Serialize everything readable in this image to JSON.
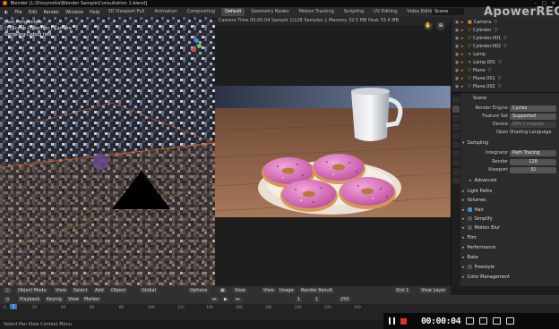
{
  "titlebar": {
    "title": "Blender [L:\\Dizzynotta\\Blender Sample\\Consultation 1.blend]"
  },
  "menu": [
    "File",
    "Edit",
    "Render",
    "Window",
    "Help"
  ],
  "workspaces": [
    {
      "label": "3D Viewport Full",
      "active": false
    },
    {
      "label": "Animation",
      "active": false
    },
    {
      "label": "Compositing",
      "active": false
    },
    {
      "label": "Default",
      "active": true
    },
    {
      "label": "Geometry Nodes",
      "active": false
    },
    {
      "label": "Motion Tracking",
      "active": false
    },
    {
      "label": "Scripting",
      "active": false
    },
    {
      "label": "UV Editing",
      "active": false
    },
    {
      "label": "Video Editing",
      "active": false
    }
  ],
  "scene": "Scene",
  "watermark": "ApowerREC",
  "left_viewport": {
    "title": "User Perspective",
    "collection": "(1) Scene Collection | Camera",
    "extra": "Sampling Debug Info",
    "toolbar": [
      "Object Mode",
      "View",
      "Select",
      "Add",
      "Object",
      "Global",
      "Options"
    ]
  },
  "right_viewport": {
    "header": "Camera   Time 00:00.04  Sample 1/128  Samples 1  Memory 32.5 MB  Peak 33.4 MB",
    "toolbar": [
      "View",
      "View",
      "Image",
      "Render Result",
      "Slot 1",
      "View Layer"
    ]
  },
  "outliner": {
    "items": [
      {
        "name": "Camera",
        "extra": "▽"
      },
      {
        "name": "Cylinder",
        "extra": "▽"
      },
      {
        "name": "Cylinder.001",
        "extra": "▽"
      },
      {
        "name": "Cylinder.002",
        "extra": "▽"
      },
      {
        "name": "Lamp",
        "extra": ""
      },
      {
        "name": "Lamp.001",
        "extra": "▽"
      },
      {
        "name": "Plane",
        "extra": "▽"
      },
      {
        "name": "Plane.001",
        "extra": "▽"
      },
      {
        "name": "Plane.002",
        "extra": "▽"
      }
    ]
  },
  "properties": {
    "scene_label": "Scene",
    "render_engine_label": "Render Engine",
    "render_engine": "Cycles",
    "feature_set_label": "Feature Set",
    "feature_set": "Supported",
    "device_label": "Device",
    "device": "GPU Compute",
    "osl_label": "Open Shading Language",
    "sampling": "Sampling",
    "integrator_label": "Integrator",
    "integrator": "Path Tracing",
    "render_label": "Render",
    "render_value": "128",
    "viewport_label": "Viewport",
    "viewport_value": "32",
    "advanced": "Advanced",
    "light_paths": "Light Paths",
    "volumes": "Volumes",
    "hair": "Hair",
    "simplify": "Simplify",
    "motion_blur": "Motion Blur",
    "film": "Film",
    "performance": "Performance",
    "bake": "Bake",
    "freestyle": "Freestyle",
    "color_management": "Color Management"
  },
  "timeline": {
    "menus": [
      "Playback",
      "Keying",
      "View",
      "Marker"
    ],
    "current_frame": "1",
    "start": "1",
    "end": "250",
    "ticks": [
      "0",
      "20",
      "40",
      "60",
      "80",
      "100",
      "120",
      "140",
      "160",
      "180",
      "200",
      "220",
      "240"
    ]
  },
  "statusbar": "Select  Pan View  Context Menu",
  "recorder": {
    "time": "00:00:04"
  }
}
